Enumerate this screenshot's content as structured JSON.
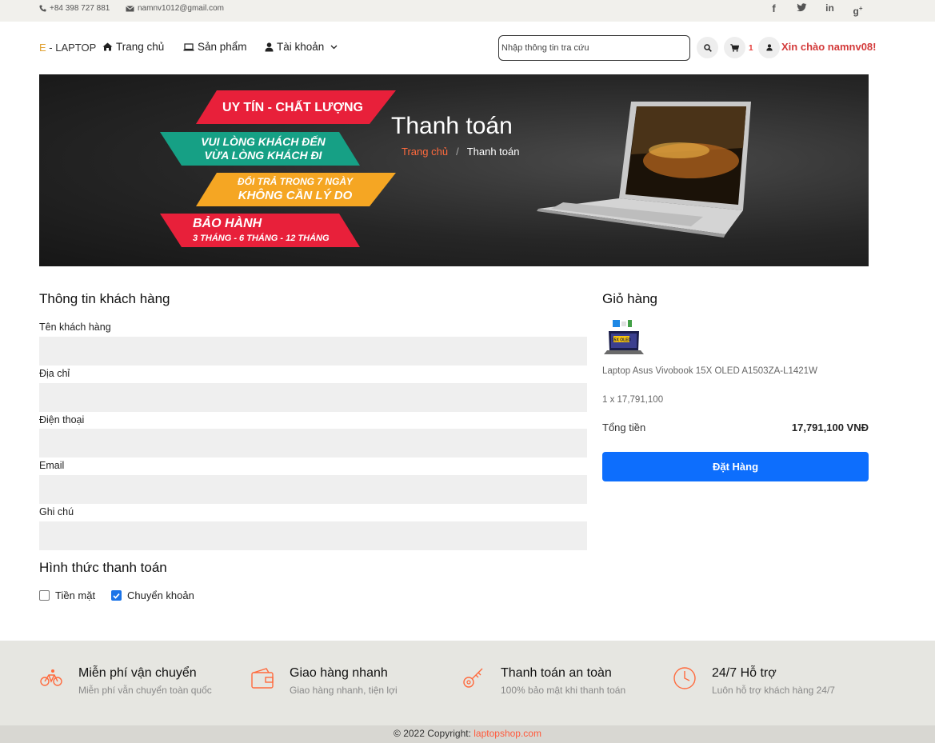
{
  "topbar": {
    "phone": "+84 398 727 881",
    "email": "namnv1012@gmail.com",
    "social": [
      "facebook-icon",
      "twitter-icon",
      "linkedin-icon",
      "google-plus-icon"
    ]
  },
  "nav": {
    "brand_e": "E",
    "brand_rest": " - LAPTOP",
    "home": "Trang chủ",
    "products": "Sản phẩm",
    "account": "Tài khoản",
    "search_placeholder": "Nhập thông tin tra cứu",
    "cart_count": "1",
    "greeting": "Xin chào namnv08!"
  },
  "banner": {
    "ribbons": {
      "r1": "UY TÍN - CHẤT LƯỢNG",
      "r2a": "VUI LÒNG KHÁCH ĐẾN",
      "r2b": "VỪA LÒNG KHÁCH ĐI",
      "r3a": "ĐỔI TRẢ TRONG 7 NGÀY",
      "r3b": "KHÔNG CẦN LÝ DO",
      "r4a": "BẢO HÀNH",
      "r4b": "3 THÁNG - 6 THÁNG - 12 THÁNG"
    },
    "title": "Thanh toán",
    "crumb_home": "Trang chủ",
    "crumb_sep": "/",
    "crumb_current": "Thanh toán"
  },
  "customer": {
    "heading": "Thông tin khách hàng",
    "name_label": "Tên khách hàng",
    "address_label": "Địa chỉ",
    "phone_label": "Điện thoại",
    "email_label": "Email",
    "note_label": "Ghi chú"
  },
  "payment": {
    "heading": "Hình thức thanh toán",
    "cash": "Tiền mặt",
    "cash_checked": false,
    "transfer": "Chuyển khoản",
    "transfer_checked": true
  },
  "cart": {
    "heading": "Giỏ hàng",
    "product_name": "Laptop Asus Vivobook 15X OLED A1503ZA-L1421W",
    "product_badge": "15X OLED",
    "qty_line": "1 x 17,791,100",
    "total_label": "Tổng tiền",
    "total_value": "17,791,100 VNĐ",
    "order_button": "Đặt Hàng"
  },
  "features": [
    {
      "title": "Miễn phí vận chuyển",
      "subtitle": "Miễn phí vẫn chuyển toàn quốc",
      "icon": "bicycle-icon"
    },
    {
      "title": "Giao hàng nhanh",
      "subtitle": "Giao hàng nhanh, tiện lợi",
      "icon": "wallet-icon"
    },
    {
      "title": "Thanh toán an toàn",
      "subtitle": "100% bảo mật khi thanh toán",
      "icon": "key-icon"
    },
    {
      "title": "24/7 Hỗ trợ",
      "subtitle": "Luôn hỗ trợ khách hàng 24/7",
      "icon": "clock-icon"
    }
  ],
  "footer": {
    "copyright_prefix": "© 2022 Copyright: ",
    "copyright_link": "laptopshop.com"
  },
  "colors": {
    "accent": "#ff5a3c",
    "primary_button": "#0d6efd",
    "greeting": "#d33a3a",
    "ribbon_red": "#e8203a",
    "ribbon_teal": "#16a085",
    "ribbon_orange": "#f5a623"
  }
}
